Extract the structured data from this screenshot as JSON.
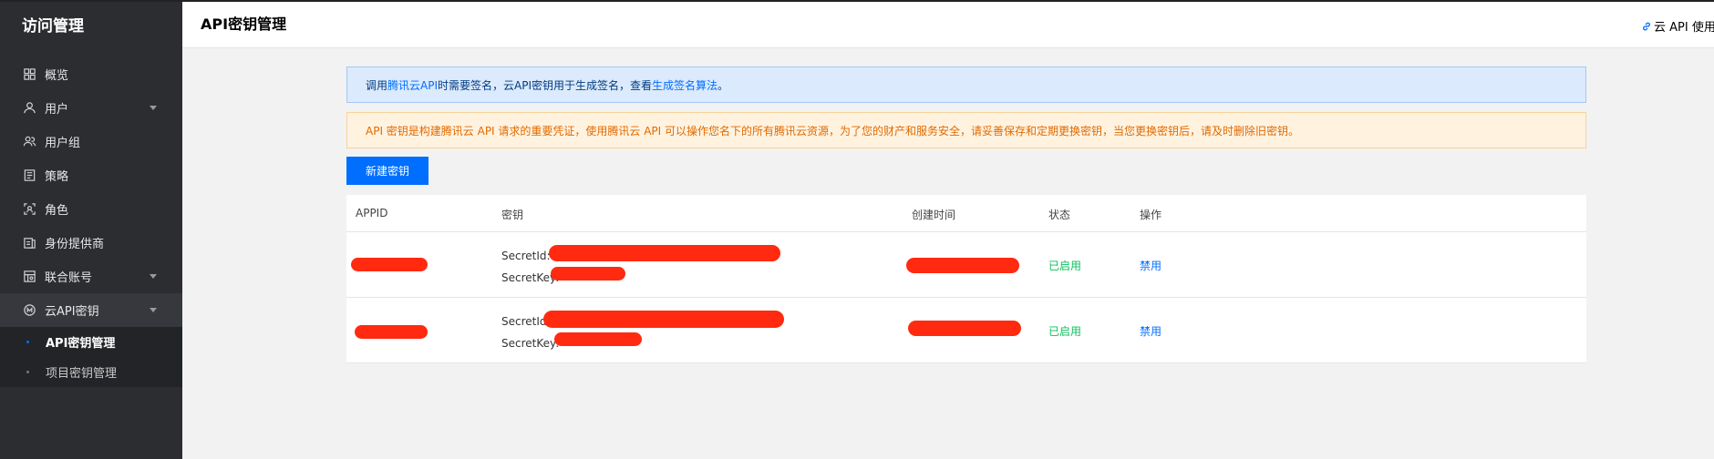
{
  "sidebar": {
    "title": "访问管理",
    "items": [
      {
        "label": "概览",
        "icon": "grid-icon"
      },
      {
        "label": "用户",
        "icon": "user-icon",
        "has_arrow": true
      },
      {
        "label": "用户组",
        "icon": "user-group-icon"
      },
      {
        "label": "策略",
        "icon": "policy-icon"
      },
      {
        "label": "角色",
        "icon": "role-icon"
      },
      {
        "label": "身份提供商",
        "icon": "identity-provider-icon"
      },
      {
        "label": "联合账号",
        "icon": "federated-account-icon",
        "has_arrow": true
      },
      {
        "label": "云API密钥",
        "icon": "api-key-icon",
        "has_arrow": true
      }
    ],
    "subitems": [
      {
        "label": "API密钥管理",
        "active": true
      },
      {
        "label": "项目密钥管理",
        "active": false
      }
    ]
  },
  "header": {
    "title": "API密钥管理",
    "doc_link": "云 API 使用文"
  },
  "alerts": {
    "info_prefix": "调用",
    "info_link1": "腾讯云API",
    "info_middle": "时需要签名，云API密钥用于生成签名，查看",
    "info_link2": "生成签名算法",
    "info_suffix": "。",
    "warning": "API 密钥是构建腾讯云 API 请求的重要凭证，使用腾讯云 API 可以操作您名下的所有腾讯云资源，为了您的财产和服务安全，请妥善保存和定期更换密钥，当您更换密钥后，请及时删除旧密钥。"
  },
  "toolbar": {
    "create_label": "新建密钥"
  },
  "table": {
    "columns": [
      "APPID",
      "密钥",
      "创建时间",
      "状态",
      "操作"
    ],
    "rows": [
      {
        "secret_id_label": "SecretId:",
        "secret_key_label": "SecretKey:",
        "status": "已启用",
        "action": "禁用"
      },
      {
        "secret_id_label": "SecretId:",
        "secret_key_label": "SecretKey:",
        "status": "已启用",
        "action": "禁用"
      }
    ]
  },
  "colors": {
    "sidebar_bg": "#2b2d31",
    "primary": "#006eff",
    "status_enabled": "#0abf5b",
    "redaction": "#ff2a10"
  }
}
